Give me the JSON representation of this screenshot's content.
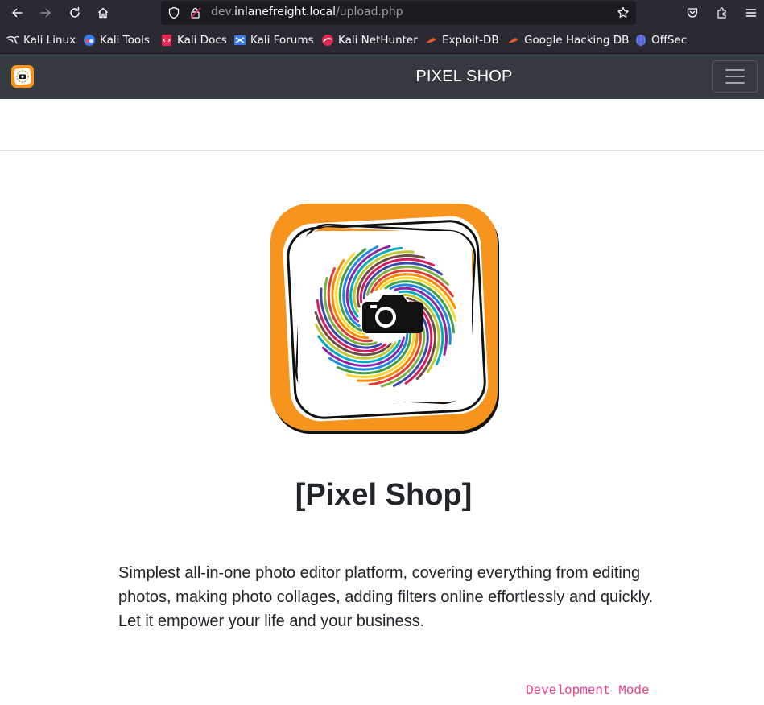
{
  "browser": {
    "url": {
      "prefix": "dev.",
      "domain": "inlanefreight.local",
      "path": "/upload.php"
    },
    "icons": [
      "back-arrow-icon",
      "forward-arrow-icon",
      "reload-icon",
      "home-icon",
      "shield-icon",
      "lock-warning-icon",
      "bookmark-star-icon",
      "pocket-icon",
      "extensions-icon",
      "hamburger-menu-icon"
    ]
  },
  "bookmarks": [
    {
      "label": "Kali Linux",
      "icon": "kali-dragon-icon"
    },
    {
      "label": "Kali Tools",
      "icon": "kali-tools-icon"
    },
    {
      "label": "Kali Docs",
      "icon": "kali-docs-icon"
    },
    {
      "label": "Kali Forums",
      "icon": "kali-forums-icon"
    },
    {
      "label": "Kali NetHunter",
      "icon": "nethunter-icon"
    },
    {
      "label": "Exploit-DB",
      "icon": "exploit-db-icon"
    },
    {
      "label": "Google Hacking DB",
      "icon": "ghdb-icon"
    },
    {
      "label": "OffSec",
      "icon": "offsec-icon"
    }
  ],
  "navbar": {
    "brand": "PIXEL SHOP",
    "toggler_icon": "navbar-toggler-icon"
  },
  "main": {
    "title": "[Pixel Shop]",
    "lead": "Simplest all-in-one photo editor platform, covering everything from editing photos, making photo collages, adding filters online effortlessly and quickly. Let it empower your life and your business.",
    "dev_mode": "Development Mode"
  },
  "colors": {
    "navbar_bg": "#343a40",
    "brand_orange": "#f7941d",
    "dev_mode_pink": "#e83e8c",
    "browser_chrome": "#2b2a33"
  }
}
